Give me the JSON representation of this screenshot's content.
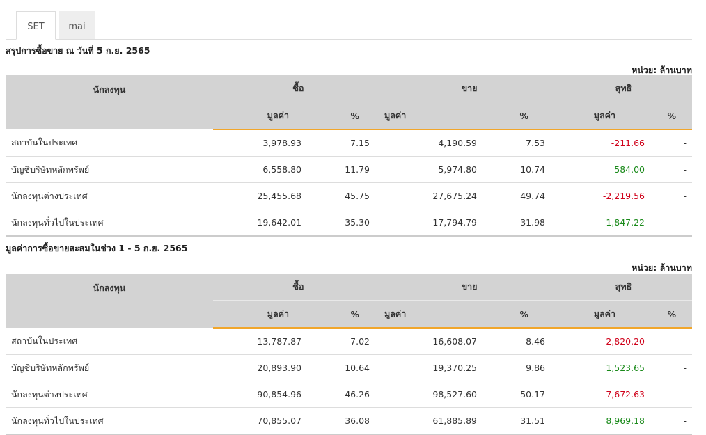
{
  "tabs": [
    "SET",
    "mai"
  ],
  "sections": [
    {
      "title": "สรุปการซื้อขาย ณ วันที่ 5 ก.ย. 2565",
      "unit": "หน่วย: ล้านบาท",
      "headers": {
        "investor": "นักลงทุน",
        "buy": "ซื้อ",
        "sell": "ขาย",
        "net": "สุทธิ",
        "value": "มูลค่า",
        "pct": "%"
      },
      "rows": [
        {
          "name": "สถาบันในประเทศ",
          "buy_value": "3,978.93",
          "buy_pct": "7.15",
          "sell_value": "4,190.59",
          "sell_pct": "7.53",
          "net_value": "-211.66",
          "net_pct": "-"
        },
        {
          "name": "บัญชีบริษัทหลักทรัพย์",
          "buy_value": "6,558.80",
          "buy_pct": "11.79",
          "sell_value": "5,974.80",
          "sell_pct": "10.74",
          "net_value": "584.00",
          "net_pct": "-"
        },
        {
          "name": "นักลงทุนต่างประเทศ",
          "buy_value": "25,455.68",
          "buy_pct": "45.75",
          "sell_value": "27,675.24",
          "sell_pct": "49.74",
          "net_value": "-2,219.56",
          "net_pct": "-"
        },
        {
          "name": "นักลงทุนทั่วไปในประเทศ",
          "buy_value": "19,642.01",
          "buy_pct": "35.30",
          "sell_value": "17,794.79",
          "sell_pct": "31.98",
          "net_value": "1,847.22",
          "net_pct": "-"
        }
      ]
    },
    {
      "title": "มูลค่าการซื้อขายสะสมในช่วง 1 - 5 ก.ย. 2565",
      "unit": "หน่วย: ล้านบาท",
      "headers": {
        "investor": "นักลงทุน",
        "buy": "ซื้อ",
        "sell": "ขาย",
        "net": "สุทธิ",
        "value": "มูลค่า",
        "pct": "%"
      },
      "rows": [
        {
          "name": "สถาบันในประเทศ",
          "buy_value": "13,787.87",
          "buy_pct": "7.02",
          "sell_value": "16,608.07",
          "sell_pct": "8.46",
          "net_value": "-2,820.20",
          "net_pct": "-"
        },
        {
          "name": "บัญชีบริษัทหลักทรัพย์",
          "buy_value": "20,893.90",
          "buy_pct": "10.64",
          "sell_value": "19,370.25",
          "sell_pct": "9.86",
          "net_value": "1,523.65",
          "net_pct": "-"
        },
        {
          "name": "นักลงทุนต่างประเทศ",
          "buy_value": "90,854.96",
          "buy_pct": "46.26",
          "sell_value": "98,527.60",
          "sell_pct": "50.17",
          "net_value": "-7,672.63",
          "net_pct": "-"
        },
        {
          "name": "นักลงทุนทั่วไปในประเทศ",
          "buy_value": "70,855.07",
          "buy_pct": "36.08",
          "sell_value": "61,885.89",
          "sell_pct": "31.51",
          "net_value": "8,969.18",
          "net_pct": "-"
        }
      ]
    }
  ],
  "colors": {
    "negative": "#d0021b",
    "positive": "#1a8a1a",
    "accent": "#f1a62b",
    "header_bg": "#d3d3d3"
  }
}
